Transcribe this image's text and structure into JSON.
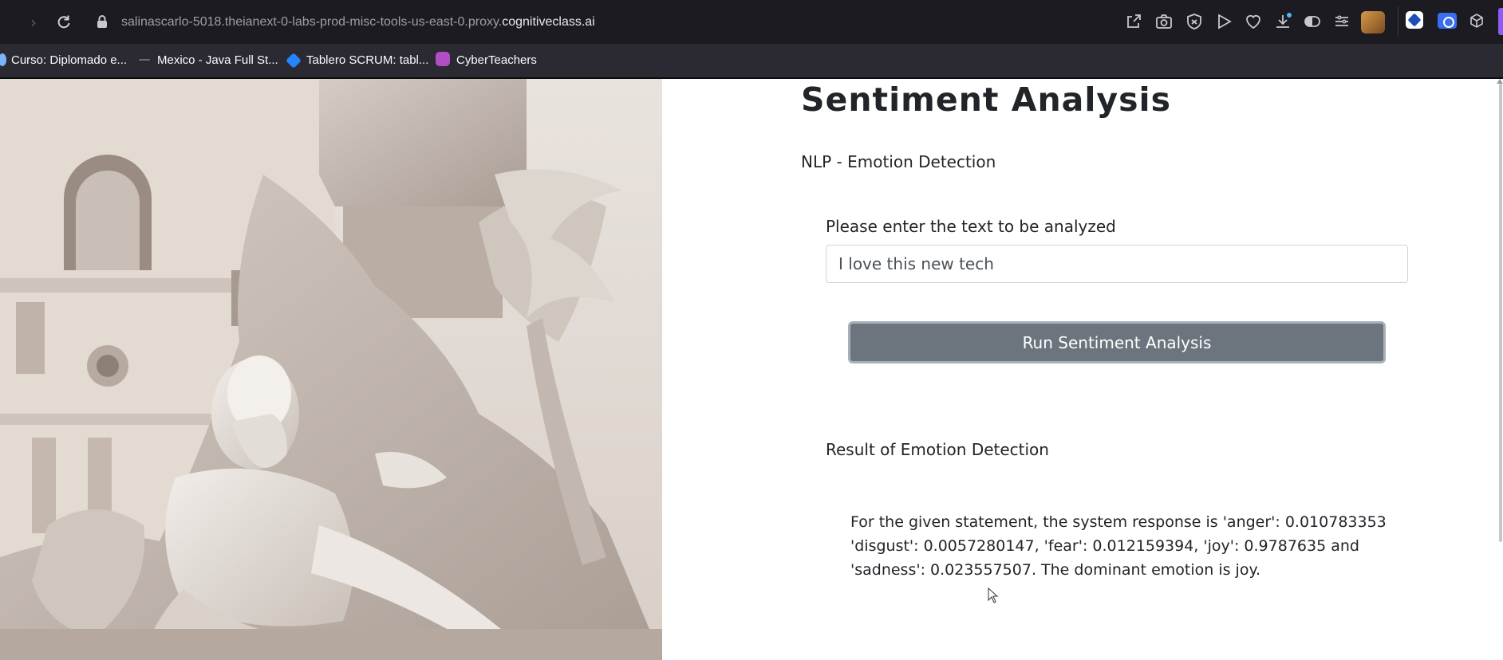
{
  "browser": {
    "url_path": "salinascarlo-5018.theianext-0-labs-prod-misc-tools-us-east-0.proxy.",
    "url_host": "cognitiveclass.ai",
    "bookmarks": [
      {
        "label": "Curso: Diplomado e..."
      },
      {
        "label": "Mexico - Java Full St..."
      },
      {
        "label": "Tablero SCRUM: tabl..."
      },
      {
        "label": "CyberTeachers"
      }
    ]
  },
  "page": {
    "title": "Sentiment Analysis",
    "subtitle": "NLP - Emotion Detection",
    "input_label": "Please enter the text to be analyzed",
    "input_value": "I love this new tech",
    "run_button": "Run Sentiment Analysis",
    "result_label": "Result of Emotion Detection",
    "result_text": "For the given statement, the system response is 'anger': 0.010783353 'disgust': 0.0057280147, 'fear': 0.012159394, 'joy': 0.9787635 and 'sadness': 0.023557507. The dominant emotion is joy."
  },
  "colors": {
    "chrome_bg": "#1c1b22",
    "bookmarks_bg": "#2b2a33",
    "button_bg": "#6c757d",
    "text": "#212529"
  },
  "icons": [
    "back-icon",
    "forward-icon",
    "reload-icon",
    "lock-icon",
    "share-icon",
    "screenshot-icon",
    "shield-icon",
    "play-icon",
    "heart-icon",
    "download-icon",
    "contrast-icon",
    "menu-icon",
    "profile-avatar",
    "extension-icon"
  ]
}
